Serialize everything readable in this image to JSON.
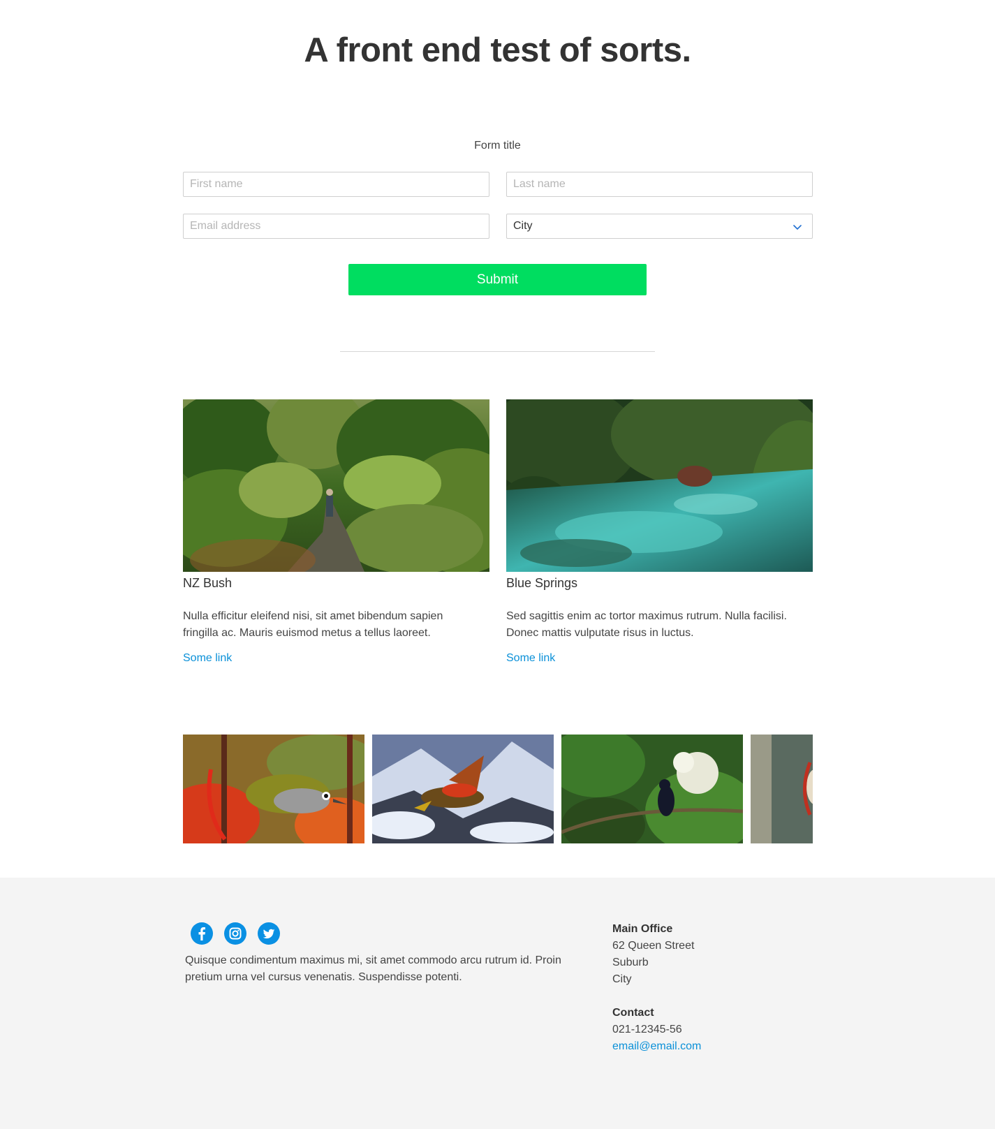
{
  "page": {
    "heading": "A front end test of sorts."
  },
  "form": {
    "title": "Form title",
    "first_name_placeholder": "First name",
    "last_name_placeholder": "Last name",
    "email_placeholder": "Email address",
    "city_selected": "City",
    "submit_label": "Submit",
    "submit_color": "#00dd60"
  },
  "cards": [
    {
      "image": "nz-bush-boardwalk-photo",
      "title": "NZ Bush",
      "text": "Nulla efficitur eleifend nisi, sit amet bibendum sapien fringilla ac. Mauris euismod metus a tellus laoreet.",
      "link": "Some link"
    },
    {
      "image": "blue-springs-stream-photo",
      "title": "Blue Springs",
      "text": "Sed sagittis enim ac tortor maximus rutrum. Nulla facilisi. Donec mattis vulputate risus in luctus.",
      "link": "Some link"
    }
  ],
  "gallery": [
    {
      "image": "silvereye-bird-photo"
    },
    {
      "image": "kea-flying-photo"
    },
    {
      "image": "tui-bird-photo"
    },
    {
      "image": "bird-partial-photo"
    }
  ],
  "footer": {
    "social": [
      {
        "icon": "facebook-icon"
      },
      {
        "icon": "instagram-icon"
      },
      {
        "icon": "twitter-icon"
      }
    ],
    "text": "Quisque condimentum maximus mi, sit amet commodo arcu rutrum id. Proin pretium urna vel cursus venenatis. Suspendisse potenti.",
    "office_heading": "Main Office",
    "address_line1": "62 Queen Street",
    "address_line2": "Suburb",
    "address_line3": "City",
    "contact_heading": "Contact",
    "phone": "021-12345-56",
    "email": "email@email.com"
  },
  "colors": {
    "accent": "#00dd60",
    "link": "#0a90d8",
    "social_blue": "#0a90e3",
    "footer_bg": "#f4f4f4"
  }
}
